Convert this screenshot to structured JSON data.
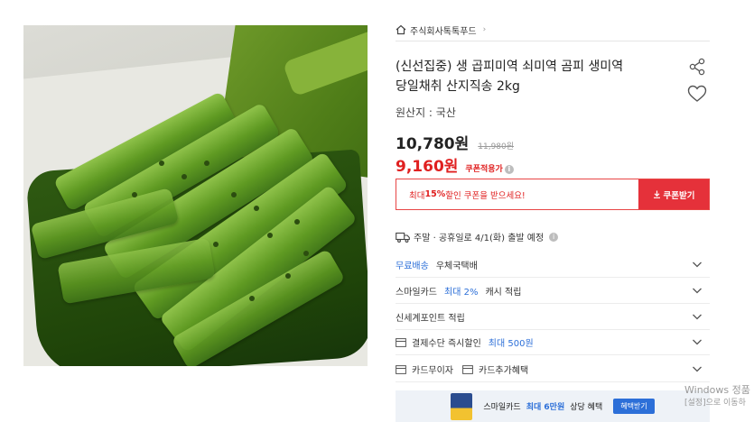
{
  "seller": {
    "name": "주식회사톡톡푸드"
  },
  "product": {
    "title_line1": "(신선집중) 생 곱피미역 쇠미역 곰피 생미역",
    "title_line2": "당일채취 산지직송 2kg",
    "origin": "원산지 : 국산",
    "price": "10,780원",
    "original_price": "11,980원",
    "coupon_price": "9,160원",
    "coupon_label": "쿠폰적용가",
    "info_icon": "i"
  },
  "coupon": {
    "msg_prefix": "최대 ",
    "msg_bold": "15%",
    "msg_suffix": " 할인 쿠폰을 받으세요!",
    "button": "쿠폰받기"
  },
  "shipping": {
    "text": "주말 · 공휴일로 4/1(화) 출발 예정",
    "info_icon": "i"
  },
  "rows": [
    {
      "label_blue": "무료배송",
      "label": "우체국택배"
    },
    {
      "label": "스마일카드",
      "label_blue": "최대 2%",
      "label2": "캐시 적립"
    },
    {
      "label": "신세계포인트 적립"
    },
    {
      "label": "결제수단 즉시할인",
      "label_blue": "최대 500원"
    },
    {
      "label": "카드무이자",
      "label2": "카드추가혜택"
    }
  ],
  "banner": {
    "text_pre": "스마일카드",
    "text_hl": "최대 6만원",
    "text_post": "상당 혜택",
    "button": "혜택받기"
  },
  "watermark": {
    "line1": "Windows 정품",
    "line2": "[설정]으로 이동하"
  },
  "colors": {
    "accent_red": "#e5313a",
    "accent_blue": "#2c6fd8"
  }
}
